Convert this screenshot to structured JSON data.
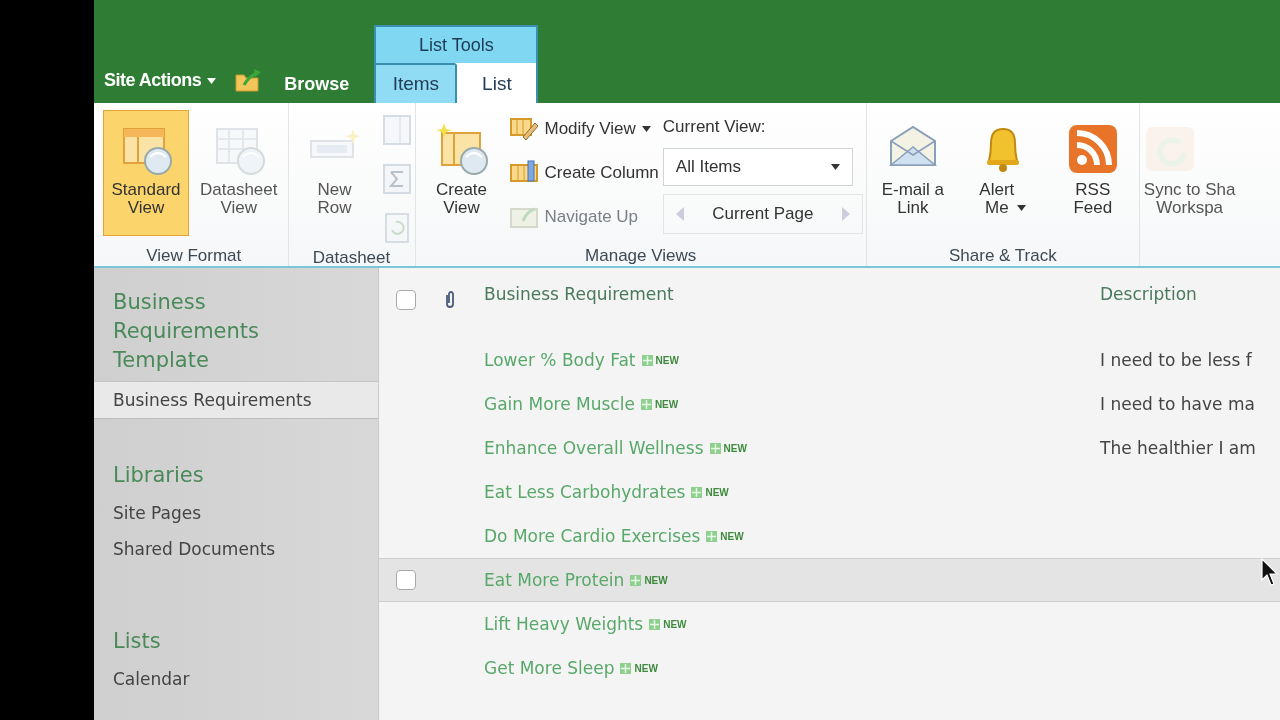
{
  "top_bar": {
    "site_actions": "Site Actions",
    "browse_tab": "Browse",
    "context_group": "List Tools",
    "tabs": [
      {
        "label": "Items",
        "selected": false
      },
      {
        "label": "List",
        "selected": true
      }
    ]
  },
  "ribbon": {
    "groups": [
      {
        "label": "View Format",
        "columns": [
          [
            {
              "kind": "large",
              "label": "Standard\nView",
              "selected": true,
              "disabled": false
            }
          ],
          [
            {
              "kind": "large",
              "label": "Datasheet\nView",
              "selected": false,
              "disabled": true
            }
          ]
        ]
      },
      {
        "label": "Datasheet",
        "columns": [
          [
            {
              "kind": "large",
              "label": "New\nRow",
              "selected": false,
              "disabled": true
            }
          ],
          [
            {
              "kind": "icon",
              "disabled": true
            },
            {
              "kind": "icon",
              "disabled": true
            },
            {
              "kind": "icon",
              "disabled": true
            }
          ]
        ]
      },
      {
        "label": "Manage Views",
        "columns": [
          [
            {
              "kind": "large",
              "label": "Create\nView",
              "selected": false,
              "disabled": false
            }
          ],
          [
            {
              "kind": "small",
              "label": "Modify View",
              "dropdown": true,
              "disabled": false
            },
            {
              "kind": "small",
              "label": "Create Column",
              "dropdown": false,
              "disabled": false
            },
            {
              "kind": "small",
              "label": "Navigate Up",
              "dropdown": false,
              "disabled": true
            }
          ],
          [
            {
              "kind": "caption",
              "label": "Current View:"
            },
            {
              "kind": "select",
              "value": "All Items"
            },
            {
              "kind": "pager",
              "label": "Current Page"
            }
          ]
        ]
      },
      {
        "label": "Share & Track",
        "columns": [
          [
            {
              "kind": "large",
              "label": "E-mail a\nLink",
              "selected": false,
              "disabled": false
            }
          ],
          [
            {
              "kind": "large",
              "label": "Alert\nMe",
              "dropdown": true,
              "selected": false,
              "disabled": false
            }
          ],
          [
            {
              "kind": "large",
              "label": "RSS\nFeed",
              "selected": false,
              "disabled": false
            }
          ]
        ]
      },
      {
        "columns": [
          [
            {
              "kind": "large",
              "label": "Sync to Sha\nWorkspa",
              "selected": false,
              "disabled": true
            }
          ]
        ]
      }
    ]
  },
  "sidebar": {
    "items": [
      {
        "kind": "title",
        "label": "Business Requirements Template"
      },
      {
        "kind": "item",
        "label": "Business Requirements",
        "selected": true
      },
      {
        "kind": "heading",
        "label": "Libraries"
      },
      {
        "kind": "item",
        "label": "Site Pages",
        "selected": false
      },
      {
        "kind": "item",
        "label": "Shared Documents",
        "selected": false
      },
      {
        "kind": "heading",
        "label": "Lists"
      },
      {
        "kind": "item",
        "label": "Calendar",
        "selected": false
      }
    ]
  },
  "list": {
    "columns": [
      "Business Requirement",
      "Description"
    ],
    "select_all_checked": false,
    "rows": [
      {
        "title": "Lower % Body Fat",
        "badge": "NEW",
        "description": "I need to be less f",
        "highlighted": false
      },
      {
        "title": "Gain More Muscle",
        "badge": "NEW",
        "description": "I need to have ma",
        "highlighted": false
      },
      {
        "title": "Enhance Overall Wellness",
        "badge": "NEW",
        "description": "The healthier I am",
        "highlighted": false
      },
      {
        "title": "Eat Less Carbohydrates",
        "badge": "NEW",
        "highlighted": false
      },
      {
        "title": "Do More Cardio Exercises",
        "badge": "NEW",
        "highlighted": false
      },
      {
        "title": "Eat More Protein",
        "badge": "NEW",
        "highlighted": true,
        "checked": false
      },
      {
        "title": "Lift Heavy Weights",
        "badge": "NEW",
        "highlighted": false
      },
      {
        "title": "Get More Sleep",
        "badge": "NEW",
        "highlighted": false
      }
    ]
  }
}
